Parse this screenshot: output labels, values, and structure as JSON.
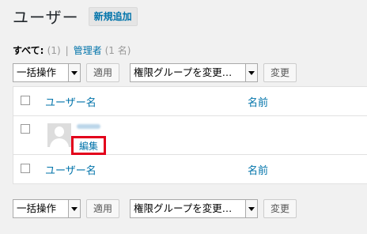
{
  "header": {
    "title": "ユーザー",
    "add_new": "新規追加"
  },
  "views": {
    "all": {
      "label": "すべて:",
      "count": "(1)"
    },
    "separator": "|",
    "admin": {
      "label": "管理者",
      "count": "(1 名)"
    }
  },
  "tablenav": {
    "bulk_action": "一括操作",
    "apply": "適用",
    "role_select": "権限グループを変更…",
    "change": "変更"
  },
  "table": {
    "columns": [
      "ユーザー名",
      "名前"
    ],
    "rows": [
      {
        "row_action": "編集"
      }
    ]
  },
  "colors": {
    "link": "#0073aa",
    "highlight": "#e3001b"
  }
}
